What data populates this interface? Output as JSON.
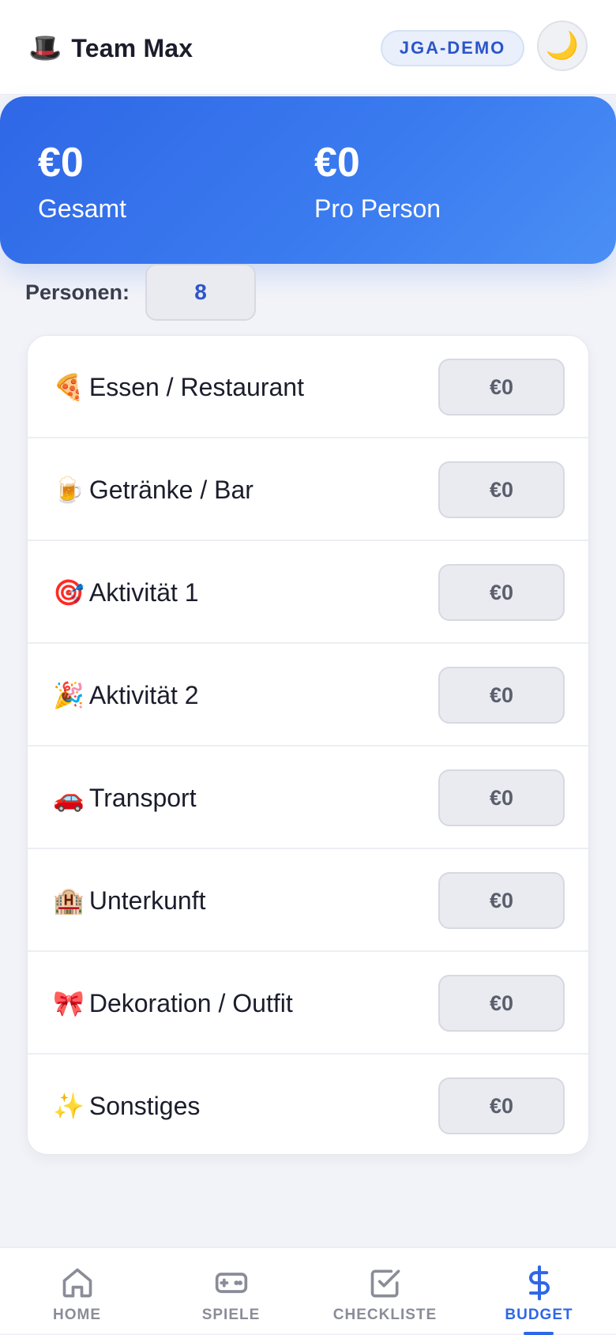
{
  "header": {
    "brand_emoji": "🎩",
    "brand_name": "Team Max",
    "badge": "JGA-DEMO",
    "theme_toggle_icon": "🌙"
  },
  "summary": {
    "total_value": "€0",
    "total_label": "Gesamt",
    "per_person_value": "€0",
    "per_person_label": "Pro Person"
  },
  "persons": {
    "label": "Personen:",
    "value": "8"
  },
  "budget_items": [
    {
      "emoji": "🍕",
      "label": "Essen / Restaurant",
      "value": "€0"
    },
    {
      "emoji": "🍺",
      "label": "Getränke / Bar",
      "value": "€0"
    },
    {
      "emoji": "🎯",
      "label": "Aktivität 1",
      "value": "€0"
    },
    {
      "emoji": "🎉",
      "label": "Aktivität 2",
      "value": "€0"
    },
    {
      "emoji": "🚗",
      "label": "Transport",
      "value": "€0"
    },
    {
      "emoji": "🏨",
      "label": "Unterkunft",
      "value": "€0"
    },
    {
      "emoji": "🎀",
      "label": "Dekoration / Outfit",
      "value": "€0"
    },
    {
      "emoji": "✨",
      "label": "Sonstiges",
      "value": "€0"
    }
  ],
  "tabs": [
    {
      "label": "HOME",
      "icon": "home-icon",
      "active": false
    },
    {
      "label": "SPIELE",
      "icon": "gamepad-icon",
      "active": false
    },
    {
      "label": "CHECKLISTE",
      "icon": "checkbox-icon",
      "active": false
    },
    {
      "label": "BUDGET",
      "icon": "dollar-icon",
      "active": true
    }
  ],
  "colors": {
    "accent": "#2f67e6",
    "tab_inactive": "#8a8c98",
    "background": "#f2f3f8"
  }
}
